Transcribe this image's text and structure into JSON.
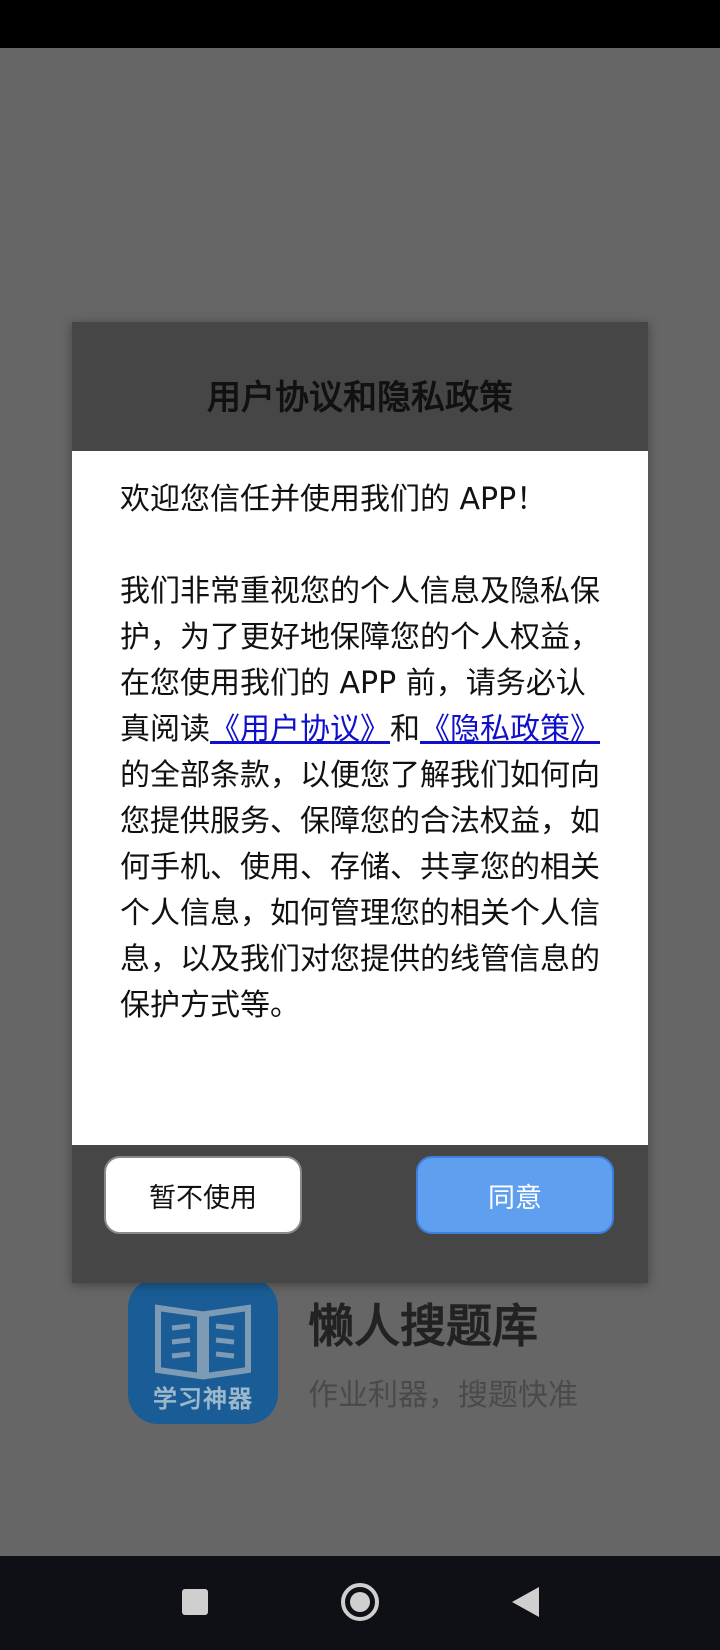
{
  "dialog": {
    "title": "用户协议和隐私政策",
    "welcome": "欢迎您信任并使用我们的 APP！",
    "body_part1": "我们非常重视您的个人信息及隐私保护，为了更好地保障您的个人权益，在您使用我们的 APP 前，请务必认真阅读",
    "user_agreement_link": "《用户协议》",
    "body_and": "和",
    "privacy_policy_link": "《隐私政策》",
    "body_part2": "的全部条款，以便您了解我们如何向您提供服务、保障您的合法权益，如何手机、使用、存储、共享您的相关个人信息，如何管理您的相关个人信息，以及我们对您提供的线管信息的保护方式等。",
    "decline_label": "暂不使用",
    "agree_label": "同意"
  },
  "splash": {
    "logo_text": "学习神器",
    "app_name": "懒人搜题库",
    "slogan": "作业利器，搜题快准"
  },
  "nav": {
    "icons": [
      "recent-apps-icon",
      "home-icon",
      "back-icon"
    ]
  },
  "colors": {
    "agree_button": "#5f9ff0",
    "link": "#1010cc",
    "dialog_header": "#464646",
    "overlay": "#666666"
  }
}
